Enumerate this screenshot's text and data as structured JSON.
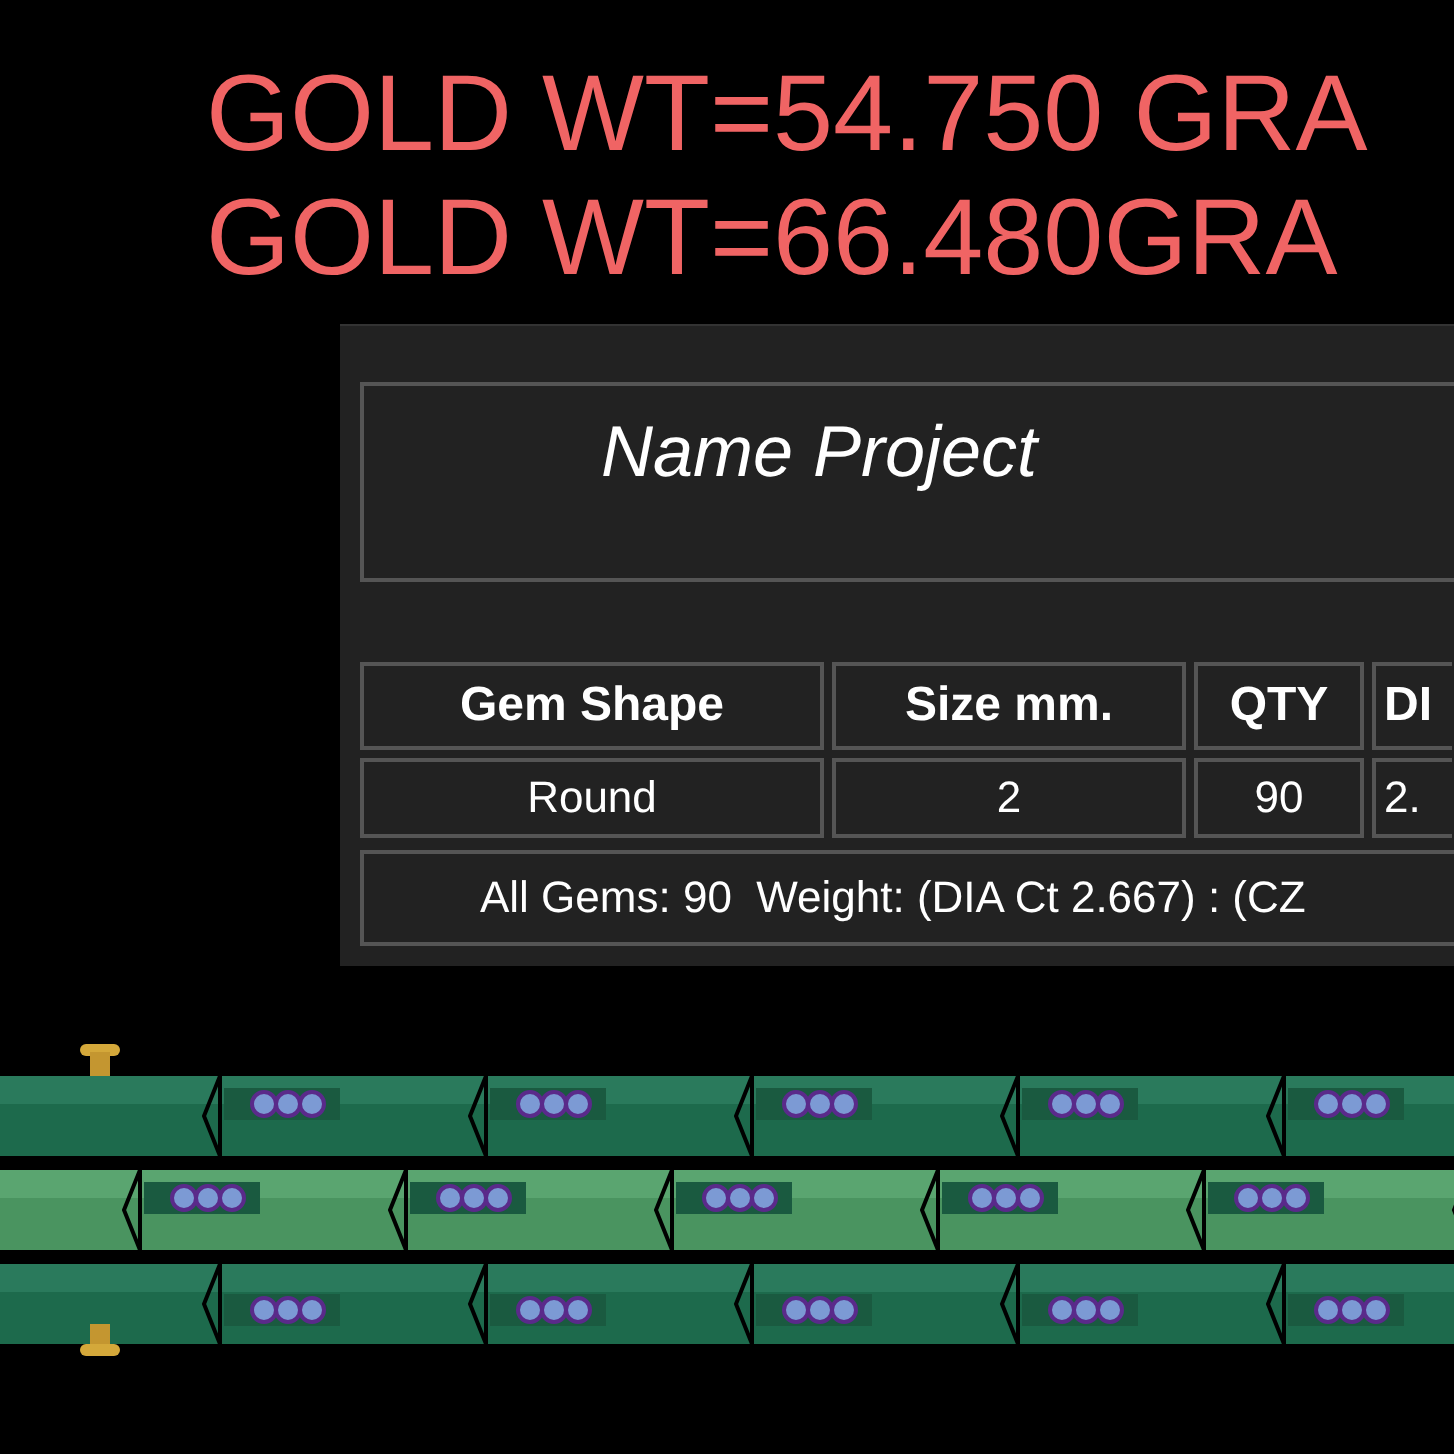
{
  "gold_weights": [
    "GOLD WT=54.750 GRA",
    "GOLD WT=66.480GRA"
  ],
  "report": {
    "project_name": "Name Project",
    "table": {
      "columns": [
        "Gem Shape",
        "Size mm.",
        "QTY",
        "DI"
      ],
      "rows": [
        [
          "Round",
          "2",
          "90",
          "2."
        ]
      ]
    },
    "summary": "All Gems: 90  Weight: (DIA Ct 2.667) : (CZ"
  }
}
